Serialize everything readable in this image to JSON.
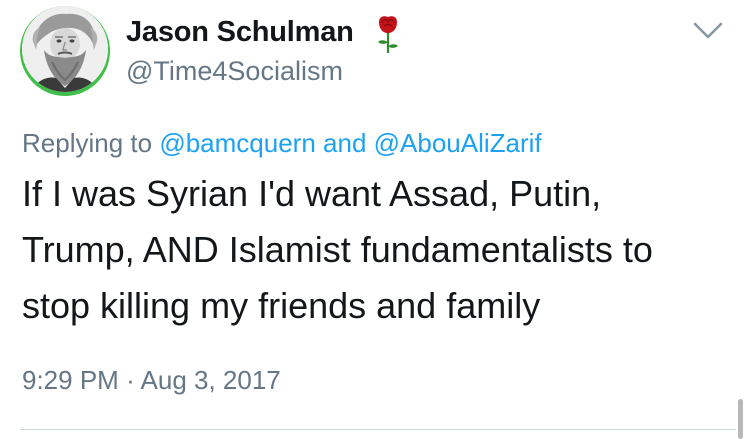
{
  "author": {
    "display_name": "Jason Schulman",
    "handle": "@Time4Socialism",
    "name_emoji": "rose-icon",
    "avatar": "profile-photo-bearded-man",
    "avatar_ring_color": "#3fbe4a"
  },
  "menu": {
    "icon": "chevron-down-icon"
  },
  "reply": {
    "prefix": "Replying to",
    "user1": "@bamcquern",
    "conjunction": "and",
    "user2": "@AbouAliZarif"
  },
  "tweet": {
    "lines": [
      "If I was Syrian I'd want Assad, Putin,",
      "Trump, AND Islamist fundamentalists to",
      "stop killing my friends and family"
    ]
  },
  "timestamp": {
    "time": "9:29 PM",
    "separator": "·",
    "date": "Aug 3, 2017"
  },
  "colors": {
    "link": "#1da1f2",
    "secondary_text": "#657786",
    "primary_text": "#14171a"
  }
}
